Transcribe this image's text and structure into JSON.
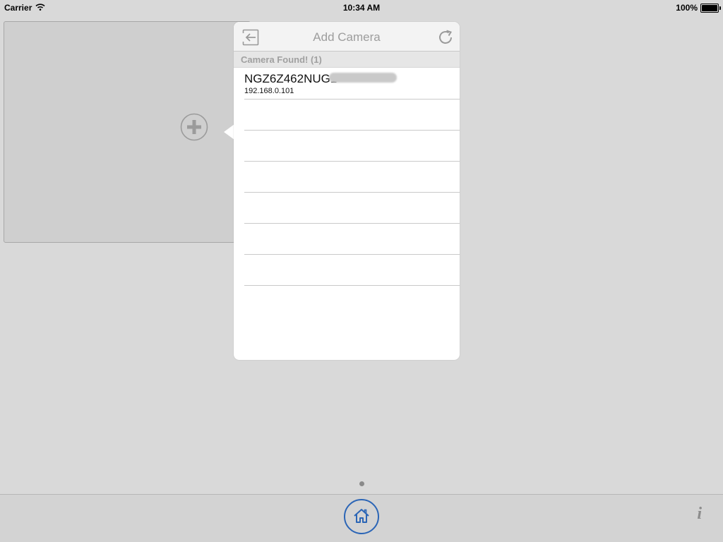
{
  "status_bar": {
    "carrier": "Carrier",
    "time": "10:34 AM",
    "battery_percent": "100%",
    "battery_level": 1.0
  },
  "camera_slot": {
    "add_icon": "plus-circle-icon"
  },
  "popover": {
    "title": "Add Camera",
    "back_icon": "back-arrow-icon",
    "refresh_icon": "refresh-icon",
    "section_header": "Camera Found! (1)",
    "cameras": [
      {
        "name": "NGZ6Z462NUG1",
        "ip": "192.168.0.101"
      }
    ],
    "empty_rows": 6
  },
  "toolbar": {
    "home_icon": "home-icon",
    "info_label": "i"
  },
  "colors": {
    "background": "#d9d9d9",
    "accent": "#2b65b6",
    "muted_text": "#9d9d9d"
  }
}
